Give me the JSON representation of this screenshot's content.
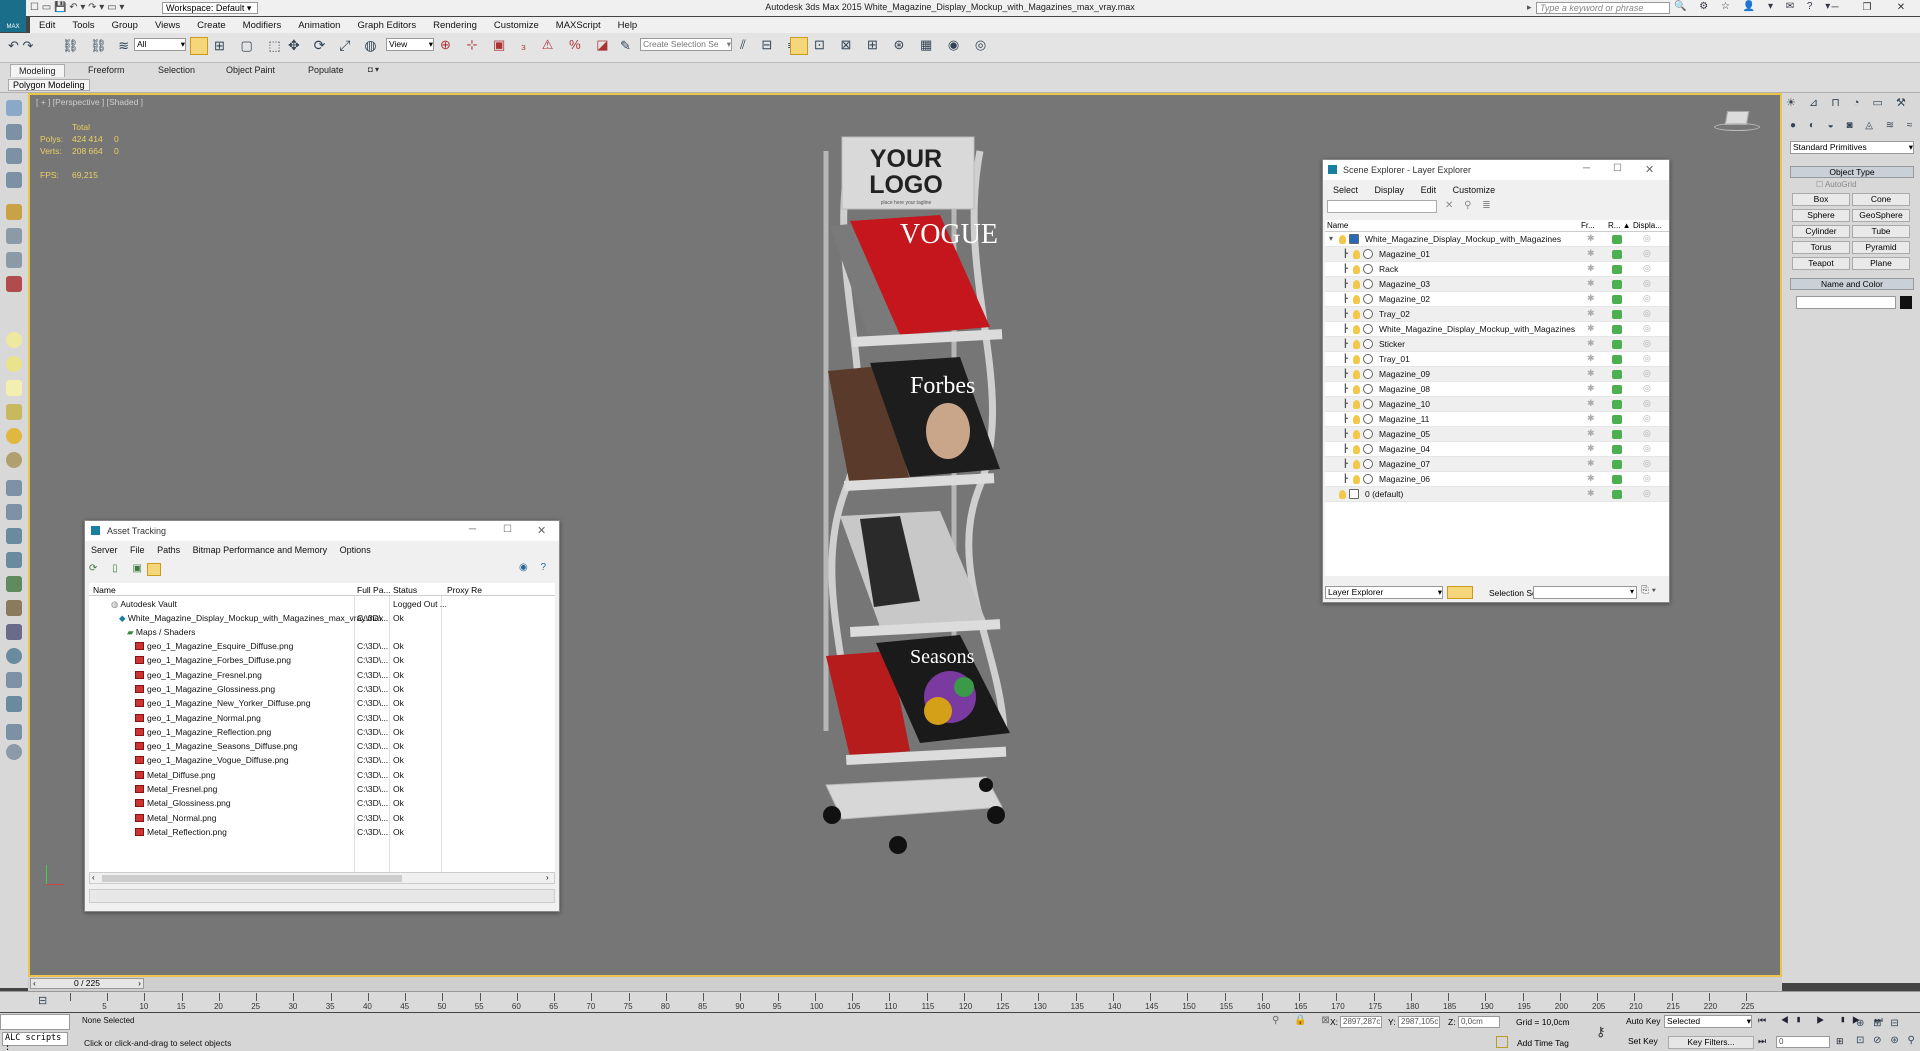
{
  "app": {
    "title": "Autodesk 3ds Max  2015    White_Magazine_Display_Mockup_with_Magazines_max_vray.max",
    "workspace": "Workspace: Default",
    "search_placeholder": "Type a keyword or phrase",
    "logo": "MAX"
  },
  "menu": [
    "Edit",
    "Tools",
    "Group",
    "Views",
    "Create",
    "Modifiers",
    "Animation",
    "Graph Editors",
    "Rendering",
    "Customize",
    "MAXScript",
    "Help"
  ],
  "toolbar": {
    "filter": "All",
    "view": "View",
    "selection_set": "Create Selection Se"
  },
  "ribbon": {
    "tabs": [
      "Modeling",
      "Freeform",
      "Selection",
      "Object Paint",
      "Populate"
    ],
    "sub": "Polygon Modeling"
  },
  "viewport": {
    "label": "[ + ] [Perspective ] [Shaded ]",
    "stats": {
      "total": "Total",
      "polys_label": "Polys:",
      "polys": "424 414",
      "polys_sel": "0",
      "verts_label": "Verts:",
      "verts": "208 664",
      "verts_sel": "0",
      "fps_label": "FPS:",
      "fps": "69,215"
    },
    "logo_top": "YOUR",
    "logo_bottom": "LOGO",
    "tagline": "place here your tagline"
  },
  "command_panel": {
    "dropdown": "Standard Primitives",
    "object_type": "Object Type",
    "autogrid": "AutoGrid",
    "buttons": [
      "Box",
      "Cone",
      "Sphere",
      "GeoSphere",
      "Cylinder",
      "Tube",
      "Torus",
      "Pyramid",
      "Teapot",
      "Plane"
    ],
    "name_color": "Name and Color"
  },
  "scene_explorer": {
    "title": "Scene Explorer - Layer Explorer",
    "menu": [
      "Select",
      "Display",
      "Edit",
      "Customize"
    ],
    "cols": [
      "Name",
      "Fr...",
      "R... ▲",
      "Displa..."
    ],
    "root": "White_Magazine_Display_Mockup_with_Magazines",
    "items": [
      "Magazine_01",
      "Rack",
      "Magazine_03",
      "Magazine_02",
      "Tray_02",
      "White_Magazine_Display_Mockup_with_Magazines",
      "Sticker",
      "Tray_01",
      "Magazine_09",
      "Magazine_08",
      "Magazine_10",
      "Magazine_11",
      "Magazine_05",
      "Magazine_04",
      "Magazine_07",
      "Magazine_06"
    ],
    "default_layer": "0 (default)",
    "footer_dropdown": "Layer Explorer",
    "selection_set": "Selection Set:"
  },
  "asset_tracking": {
    "title": "Asset Tracking",
    "menu": [
      "Server",
      "File",
      "Paths",
      "Bitmap Performance and Memory",
      "Options"
    ],
    "cols": [
      "Name",
      "Full Pa...",
      "Status",
      "Proxy Re"
    ],
    "vault": {
      "name": "Autodesk Vault",
      "status": "Logged Out ..."
    },
    "file": {
      "name": "White_Magazine_Display_Mockup_with_Magazines_max_vray.max",
      "path": "C:\\3D\\...",
      "status": "Ok"
    },
    "maps_folder": "Maps / Shaders",
    "rows": [
      {
        "name": "geo_1_Magazine_Esquire_Diffuse.png",
        "path": "C:\\3D\\...",
        "status": "Ok"
      },
      {
        "name": "geo_1_Magazine_Forbes_Diffuse.png",
        "path": "C:\\3D\\...",
        "status": "Ok"
      },
      {
        "name": "geo_1_Magazine_Fresnel.png",
        "path": "C:\\3D\\...",
        "status": "Ok"
      },
      {
        "name": "geo_1_Magazine_Glossiness.png",
        "path": "C:\\3D\\...",
        "status": "Ok"
      },
      {
        "name": "geo_1_Magazine_New_Yorker_Diffuse.png",
        "path": "C:\\3D\\...",
        "status": "Ok"
      },
      {
        "name": "geo_1_Magazine_Normal.png",
        "path": "C:\\3D\\...",
        "status": "Ok"
      },
      {
        "name": "geo_1_Magazine_Reflection.png",
        "path": "C:\\3D\\...",
        "status": "Ok"
      },
      {
        "name": "geo_1_Magazine_Seasons_Diffuse.png",
        "path": "C:\\3D\\...",
        "status": "Ok"
      },
      {
        "name": "geo_1_Magazine_Vogue_Diffuse.png",
        "path": "C:\\3D\\...",
        "status": "Ok"
      },
      {
        "name": "Metal_Diffuse.png",
        "path": "C:\\3D\\...",
        "status": "Ok"
      },
      {
        "name": "Metal_Fresnel.png",
        "path": "C:\\3D\\...",
        "status": "Ok"
      },
      {
        "name": "Metal_Glossiness.png",
        "path": "C:\\3D\\...",
        "status": "Ok"
      },
      {
        "name": "Metal_Normal.png",
        "path": "C:\\3D\\...",
        "status": "Ok"
      },
      {
        "name": "Metal_Reflection.png",
        "path": "C:\\3D\\...",
        "status": "Ok"
      }
    ]
  },
  "timeline": {
    "frame": "0 / 225",
    "ticks": [
      "0",
      "5",
      "10",
      "15",
      "20",
      "25",
      "30",
      "35",
      "40",
      "45",
      "50",
      "55",
      "60",
      "65",
      "70",
      "75",
      "80",
      "85",
      "90",
      "95",
      "100",
      "105",
      "110",
      "115",
      "120",
      "125",
      "130",
      "135",
      "140",
      "145",
      "150",
      "155",
      "160",
      "165",
      "170",
      "175",
      "180",
      "185",
      "190",
      "195",
      "200",
      "205",
      "210",
      "215",
      "220",
      "225"
    ]
  },
  "status": {
    "script": "ALC scripts :",
    "selection": "None Selected",
    "hint": "Click or click-and-drag to select objects",
    "x_label": "X:",
    "x": "2897,287c",
    "y_label": "Y:",
    "y": "2987,105c",
    "z_label": "Z:",
    "z": "0,0cm",
    "grid": "Grid = 10,0cm",
    "add_time_tag": "Add Time Tag",
    "auto_key": "Auto Key",
    "selected": "Selected",
    "set_key": "Set Key",
    "key_filters": "Key Filters...",
    "frame_field": "0"
  },
  "colors": {
    "accent": "#e9c54a",
    "viewport": "#767676",
    "panel": "#f0f0f0"
  }
}
